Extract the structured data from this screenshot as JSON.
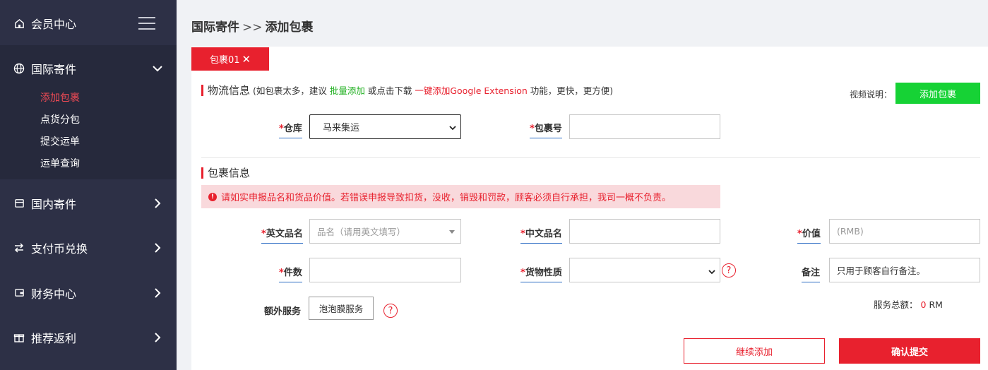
{
  "colors": {
    "sidebar_bg": "#2d3046",
    "accent_red": "#e8212e",
    "green": "#16d235",
    "alert_bg": "#f9d9dc"
  },
  "sidebar": {
    "member": "会员中心",
    "intl": "国际寄件",
    "intl_sub": [
      "添加包裹",
      "点货分包",
      "提交运单",
      "运单查询"
    ],
    "domestic": "国内寄件",
    "exchange": "支付币兑换",
    "finance": "财务中心",
    "referral": "推荐返利"
  },
  "breadcrumb": {
    "parent": "国际寄件",
    "sep": ">>",
    "current": "添加包裹"
  },
  "tab": {
    "label": "包裹01",
    "close": "✕"
  },
  "logistics": {
    "title": "物流信息",
    "note_prefix": "(如包裹太多，建议 ",
    "bulk_link": "批量添加",
    "note_mid": " 或点击下载 ",
    "ext_link": "一键添加Google Extension",
    "note_suffix": " 功能，更快，更方便)",
    "video_label": "视频说明：",
    "add_button": "添加包裹",
    "warehouse_label": "仓库",
    "warehouse_value": "马来集运",
    "parcel_no_label": "包裹号"
  },
  "parcel": {
    "title": "包裹信息",
    "alert": "请如实申报品名和货品价值。若错误申报导致扣货，没收，销毁和罚款，顾客必须自行承担，我司一概不负责。",
    "en_name_label": "英文品名",
    "en_name_placeholder": "品名（请用英文填写）",
    "cn_name_label": "中文品名",
    "value_label": "价值",
    "value_placeholder": "(RMB)",
    "qty_label": "件数",
    "nature_label": "货物性质",
    "remark_label": "备注",
    "remark_placeholder": "只用于顾客自行备注。",
    "extra_label": "额外服务",
    "bubble_button": "泡泡膜服务",
    "svc_total_label": "服务总额：",
    "svc_total_value": "0",
    "svc_total_unit": "RM"
  },
  "actions": {
    "continue": "继续添加",
    "submit": "确认提交"
  }
}
